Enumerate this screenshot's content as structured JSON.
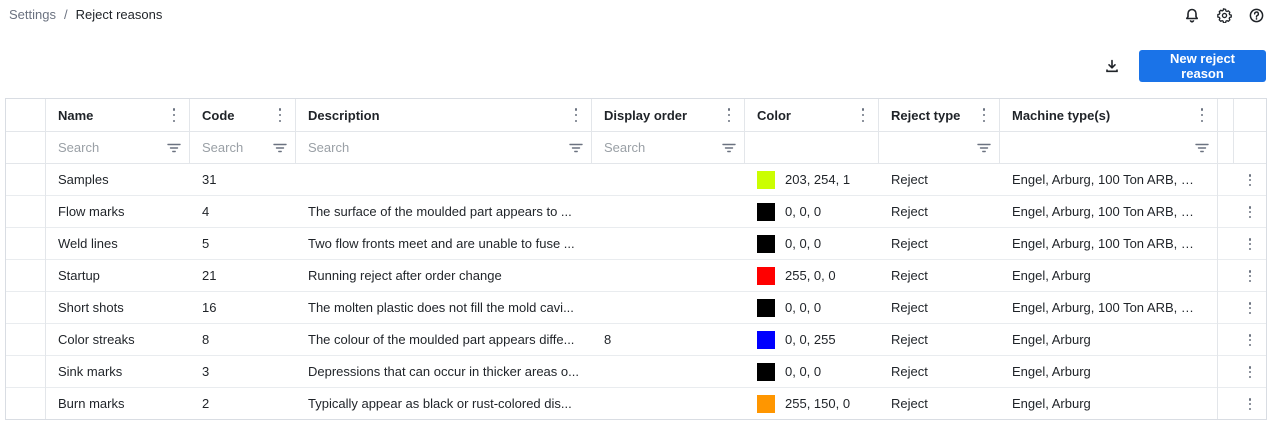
{
  "breadcrumb": {
    "parent": "Settings",
    "separator": "/",
    "current": "Reject reasons"
  },
  "header_icons": [
    "bell-icon",
    "gear-icon",
    "help-icon"
  ],
  "toolbar": {
    "new_button": "New reject reason",
    "download_icon": "download-icon"
  },
  "colors": {
    "accent": "#1a73e8"
  },
  "table": {
    "columns": [
      "Name",
      "Code",
      "Description",
      "Display order",
      "Color",
      "Reject type",
      "Machine type(s)"
    ],
    "filter_placeholders": {
      "name": "Search",
      "code": "Search",
      "description": "Search",
      "display_order": "Search"
    },
    "rows": [
      {
        "name": "Samples",
        "code": "31",
        "description": "",
        "display_order": "",
        "color_hex": "#cbfe01",
        "color_rgb": "203, 254, 1",
        "reject_type": "Reject",
        "machines": "Engel, Arburg, 100 Ton ARB, 25..."
      },
      {
        "name": "Flow marks",
        "code": "4",
        "description": "The surface of the moulded part appears to ...",
        "display_order": "",
        "color_hex": "#000000",
        "color_rgb": "0, 0, 0",
        "reject_type": "Reject",
        "machines": "Engel, Arburg, 100 Ton ARB, 25..."
      },
      {
        "name": "Weld lines",
        "code": "5",
        "description": "Two flow fronts meet and are unable to fuse ...",
        "display_order": "",
        "color_hex": "#000000",
        "color_rgb": "0, 0, 0",
        "reject_type": "Reject",
        "machines": "Engel, Arburg, 100 Ton ARB, 25..."
      },
      {
        "name": "Startup",
        "code": "21",
        "description": "Running reject after order change",
        "display_order": "",
        "color_hex": "#ff0000",
        "color_rgb": "255, 0, 0",
        "reject_type": "Reject",
        "machines": "Engel, Arburg"
      },
      {
        "name": "Short shots",
        "code": "16",
        "description": "The molten plastic does not fill the mold cavi...",
        "display_order": "",
        "color_hex": "#000000",
        "color_rgb": "0, 0, 0",
        "reject_type": "Reject",
        "machines": "Engel, Arburg, 100 Ton ARB, 25..."
      },
      {
        "name": "Color streaks",
        "code": "8",
        "description": "The colour of the moulded part appears diffe...",
        "display_order": "8",
        "color_hex": "#0000ff",
        "color_rgb": "0, 0, 255",
        "reject_type": "Reject",
        "machines": "Engel, Arburg"
      },
      {
        "name": "Sink marks",
        "code": "3",
        "description": "Depressions that can occur in thicker areas o...",
        "display_order": "",
        "color_hex": "#000000",
        "color_rgb": "0, 0, 0",
        "reject_type": "Reject",
        "machines": "Engel, Arburg"
      },
      {
        "name": "Burn marks",
        "code": "2",
        "description": "Typically appear as black or rust-colored dis...",
        "display_order": "",
        "color_hex": "#ff9600",
        "color_rgb": "255, 150, 0",
        "reject_type": "Reject",
        "machines": "Engel, Arburg"
      }
    ]
  }
}
